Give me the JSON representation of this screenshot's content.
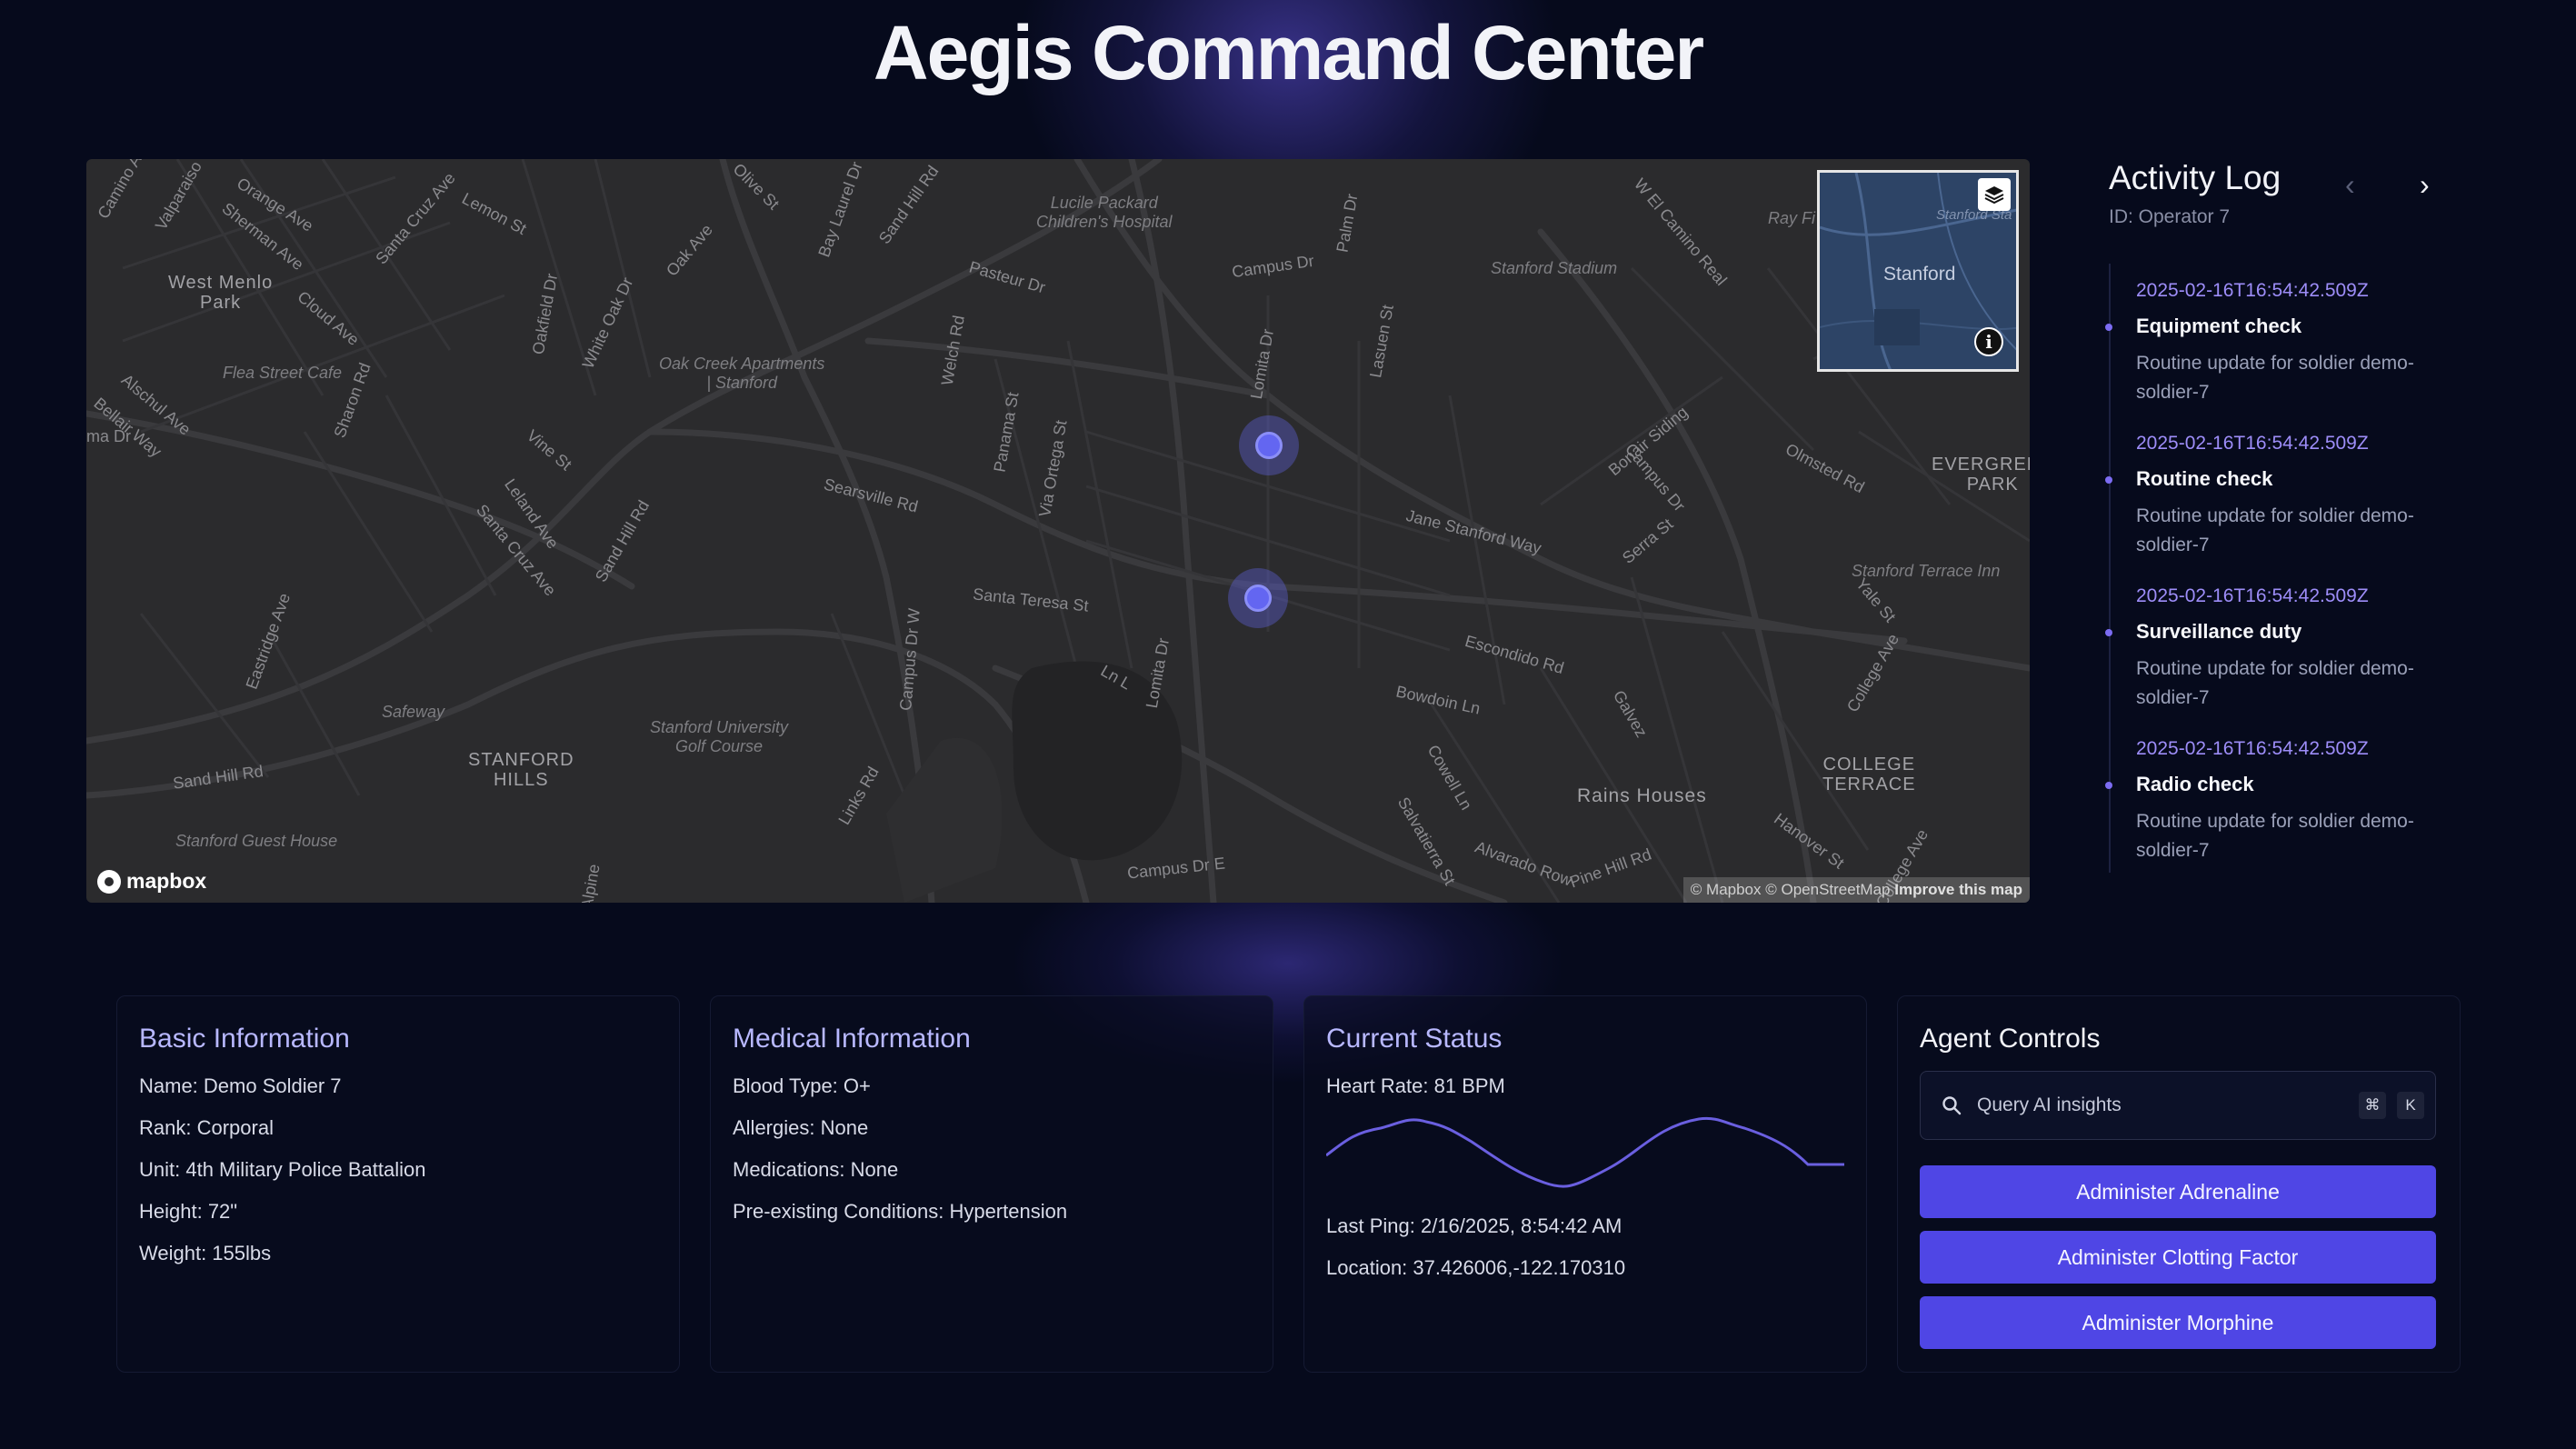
{
  "app": {
    "title": "Aegis Command Center"
  },
  "map": {
    "labels": {
      "west_menlo_park": "West Menlo\nPark",
      "stanford_hills": "STANFORD\nHILLS",
      "evergreen_park": "EVERGREEN\nPARK",
      "college_terrace": "COLLEGE\nTERRACE",
      "rains_houses": "Rains Houses",
      "stanford_stadium": "Stanford Stadium",
      "lucile_packard": "Lucile Packard\nChildren's Hospital",
      "oak_creek": "Oak Creek Apartments\n| Stanford",
      "golf_course": "Stanford University\nGolf Course",
      "flea_street": "Flea Street Cafe",
      "guest_house": "Stanford Guest House",
      "terrace_inn": "Stanford Terrace Inn",
      "safeway": "Safeway",
      "campus_dr": "Campus Dr",
      "campus_dr_e": "Campus Dr E",
      "sand_hill_rd": "Sand Hill Rd",
      "searsville_rd": "Searsville Rd",
      "santa_teresa": "Santa Teresa St",
      "jane_stanford": "Jane Stanford Way",
      "escondido_rd": "Escondido Rd",
      "bowdoin_ln": "Bowdoin Ln",
      "pasteur_dr": "Pasteur Dr",
      "olmsted_rd": "Olmsted Rd",
      "el_camino": "W El Camino Real",
      "orange_ave": "Orange Ave",
      "sherman_ave": "Sherman Ave",
      "santa_cruz_ave": "Santa Cruz Ave",
      "lemon_st": "Lemon St",
      "oak_ave": "Oak Ave",
      "olive_st": "Olive St",
      "bay_laurel": "Bay Laurel Dr",
      "palm_dr": "Palm Dr",
      "vine_st": "Vine St",
      "leland_ave": "Leland Ave",
      "cloud_ave": "Cloud Ave",
      "sharon_rd": "Sharon Rd",
      "alpine": "Alpine",
      "eastridge": "Eastridge Ave",
      "valparaiso": "Valparaiso",
      "alschul": "Alschul Ave",
      "bellair": "Bellair Way",
      "camino": "Camino A",
      "ma_dr": "ma Dr",
      "welch_rd": "Welch Rd",
      "panama": "Panama St",
      "via_ortega": "Via Ortega St",
      "lomita_dr": "Lomita Dr",
      "lasuen": "Lasuen St",
      "galvez": "Galvez",
      "bonair": "Bonair Siding",
      "serra_st": "Serra St",
      "yale_st": "Yale St",
      "college_ave": "College Ave",
      "hanover": "Hanover St",
      "pine_hill": "Pine Hill Rd",
      "alvarado": "Alvarado Row",
      "salvatierra": "Salvatierra St",
      "cowell_ln": "Cowell Ln",
      "links_rd": "Links Rd",
      "campus_dr_w": "Campus Dr W",
      "ln_l": "Ln L",
      "oakfield": "Oakfield Dr",
      "white_oak": "White Oak Dr",
      "sand_hill_rd2": "Sand Hill Rd",
      "stanford_a": "Stanford Sta",
      "minimap_stanford": "Stanford",
      "ray_fi": "Ray Fi"
    },
    "logo_text": "mapbox",
    "attribution": "© Mapbox © OpenStreetMap",
    "attribution_link": "Improve this map",
    "info_glyph": "i"
  },
  "activity_log": {
    "title": "Activity Log",
    "subtitle": "ID: Operator 7",
    "prev_glyph": "‹",
    "next_glyph": "›",
    "entries": [
      {
        "timestamp": "2025-02-16T16:54:42.509Z",
        "title": "Equipment check",
        "description": "Routine update for soldier demo-soldier-7"
      },
      {
        "timestamp": "2025-02-16T16:54:42.509Z",
        "title": "Routine check",
        "description": "Routine update for soldier demo-soldier-7"
      },
      {
        "timestamp": "2025-02-16T16:54:42.509Z",
        "title": "Surveillance duty",
        "description": "Routine update for soldier demo-soldier-7"
      },
      {
        "timestamp": "2025-02-16T16:54:42.509Z",
        "title": "Radio check",
        "description": "Routine update for soldier demo-soldier-7"
      }
    ]
  },
  "basic_info": {
    "title": "Basic Information",
    "name": "Name: Demo Soldier 7",
    "rank": "Rank: Corporal",
    "unit": "Unit: 4th Military Police Battalion",
    "height": "Height: 72\"",
    "weight": "Weight: 155lbs"
  },
  "medical_info": {
    "title": "Medical Information",
    "blood_type": "Blood Type: O+",
    "allergies": "Allergies: None",
    "medications": "Medications: None",
    "conditions": "Pre-existing Conditions: Hypertension"
  },
  "current_status": {
    "title": "Current Status",
    "heart_rate": "Heart Rate: 81 BPM",
    "last_ping": "Last Ping: 2/16/2025, 8:54:42 AM",
    "location": "Location: 37.426006,-122.170310"
  },
  "agent_controls": {
    "title": "Agent Controls",
    "search_placeholder": "Query AI insights",
    "kbd_cmd": "⌘",
    "kbd_k": "K",
    "buttons": [
      "Administer Adrenaline",
      "Administer Clotting Factor",
      "Administer Morphine"
    ]
  },
  "colors": {
    "accent": "#4f46e5",
    "marker": "#6366f1",
    "background": "#060a1c",
    "card_title": "#b8b8ff"
  }
}
